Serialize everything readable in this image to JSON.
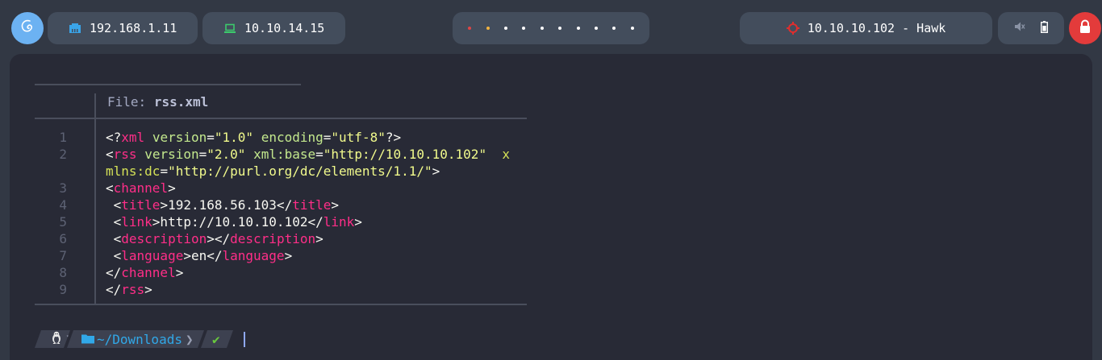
{
  "topbar": {
    "local_ip": "192.168.1.11",
    "vpn_ip": "10.10.14.15",
    "target_label": "10.10.10.102 - Hawk",
    "workspace_count": 10,
    "icons": {
      "logo": "debian-swirl-icon",
      "local": "ethernet-icon",
      "vpn": "laptop-icon",
      "target": "crosshair-icon",
      "mute": "speaker-muted-icon",
      "battery": "battery-icon",
      "lock": "lock-icon"
    },
    "colors": {
      "local_icon": "#3aa4e8",
      "vpn_icon": "#3cc96c",
      "target_icon": "#e02d2d",
      "lock_bg": "#e33b3b",
      "logo_bg": "#6cb2f2"
    }
  },
  "viewer": {
    "file_label": "File:",
    "file_name": "rss.xml",
    "lines": [
      {
        "n": "1",
        "html_parts": [
          [
            "",
            "<?"
          ],
          [
            "t",
            "xml"
          ],
          [
            "",
            " "
          ],
          [
            "a",
            "version"
          ],
          [
            "",
            "="
          ],
          [
            "s",
            "\"1.0\""
          ],
          [
            "",
            " "
          ],
          [
            "a",
            "encoding"
          ],
          [
            "",
            "="
          ],
          [
            "s",
            "\"utf-8\""
          ],
          [
            "",
            "?>"
          ]
        ]
      },
      {
        "n": "2",
        "html_parts": [
          [
            "",
            "<"
          ],
          [
            "t",
            "rss"
          ],
          [
            "",
            " "
          ],
          [
            "a",
            "version"
          ],
          [
            "",
            "="
          ],
          [
            "s",
            "\"2.0\""
          ],
          [
            "",
            " "
          ],
          [
            "a",
            "xml:base"
          ],
          [
            "",
            "="
          ],
          [
            "s",
            "\"http://10.10.10.102\""
          ],
          [
            "",
            "  "
          ],
          [
            "a2",
            "x"
          ]
        ]
      },
      {
        "n": "",
        "html_parts": [
          [
            "a2",
            "mlns:dc"
          ],
          [
            "",
            "="
          ],
          [
            "s",
            "\"http://purl.org/dc/elements/1.1/\""
          ],
          [
            "",
            ">"
          ]
        ]
      },
      {
        "n": "3",
        "html_parts": [
          [
            "",
            "<"
          ],
          [
            "t",
            "channel"
          ],
          [
            "",
            ">"
          ]
        ]
      },
      {
        "n": "4",
        "html_parts": [
          [
            "",
            " <"
          ],
          [
            "t",
            "title"
          ],
          [
            "",
            ">192.168.56.103</"
          ],
          [
            "t",
            "title"
          ],
          [
            "",
            ">"
          ]
        ]
      },
      {
        "n": "5",
        "html_parts": [
          [
            "",
            " <"
          ],
          [
            "t",
            "link"
          ],
          [
            "",
            ">http://10.10.10.102</"
          ],
          [
            "t",
            "link"
          ],
          [
            "",
            ">"
          ]
        ]
      },
      {
        "n": "6",
        "html_parts": [
          [
            "",
            " <"
          ],
          [
            "t",
            "description"
          ],
          [
            "",
            "></"
          ],
          [
            "t",
            "description"
          ],
          [
            "",
            ">"
          ]
        ]
      },
      {
        "n": "7",
        "html_parts": [
          [
            "",
            " <"
          ],
          [
            "t",
            "language"
          ],
          [
            "",
            ">en</"
          ],
          [
            "t",
            "language"
          ],
          [
            "",
            ">"
          ]
        ]
      },
      {
        "n": "8",
        "html_parts": [
          [
            "",
            "</"
          ],
          [
            "t",
            "channel"
          ],
          [
            "",
            ">"
          ]
        ]
      },
      {
        "n": "9",
        "html_parts": [
          [
            "",
            "</"
          ],
          [
            "t",
            "rss"
          ],
          [
            "",
            ">"
          ]
        ]
      }
    ]
  },
  "prompt": {
    "os_icon": "linux-tux-icon",
    "folder_icon": "folder-icon",
    "path": "~/Downloads",
    "status": "✔"
  }
}
